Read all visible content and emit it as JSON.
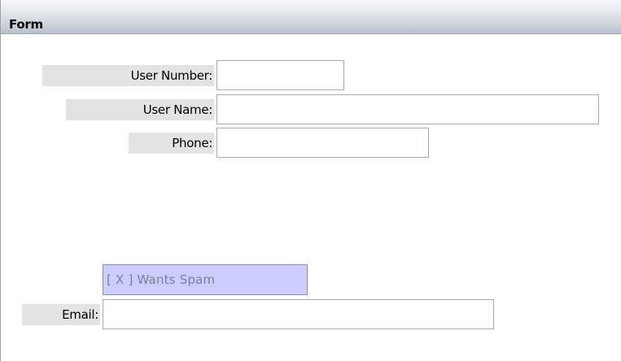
{
  "form": {
    "title": "Form",
    "fields": {
      "user_number": {
        "label": "User Number:",
        "value": ""
      },
      "user_name": {
        "label": "User Name:",
        "value": ""
      },
      "phone": {
        "label": "Phone:",
        "value": ""
      },
      "email": {
        "label": "Email:",
        "value": ""
      }
    },
    "wants_spam": {
      "label": "[ X ] Wants Spam",
      "checked": true
    }
  },
  "colors": {
    "header_gradient_top": "#f7f8fa",
    "header_gradient_bottom": "#b9c1cc",
    "label_background": "#e3e3e3",
    "checkbox_background": "#ccccff",
    "checkbox_text": "#7f7f9a"
  }
}
